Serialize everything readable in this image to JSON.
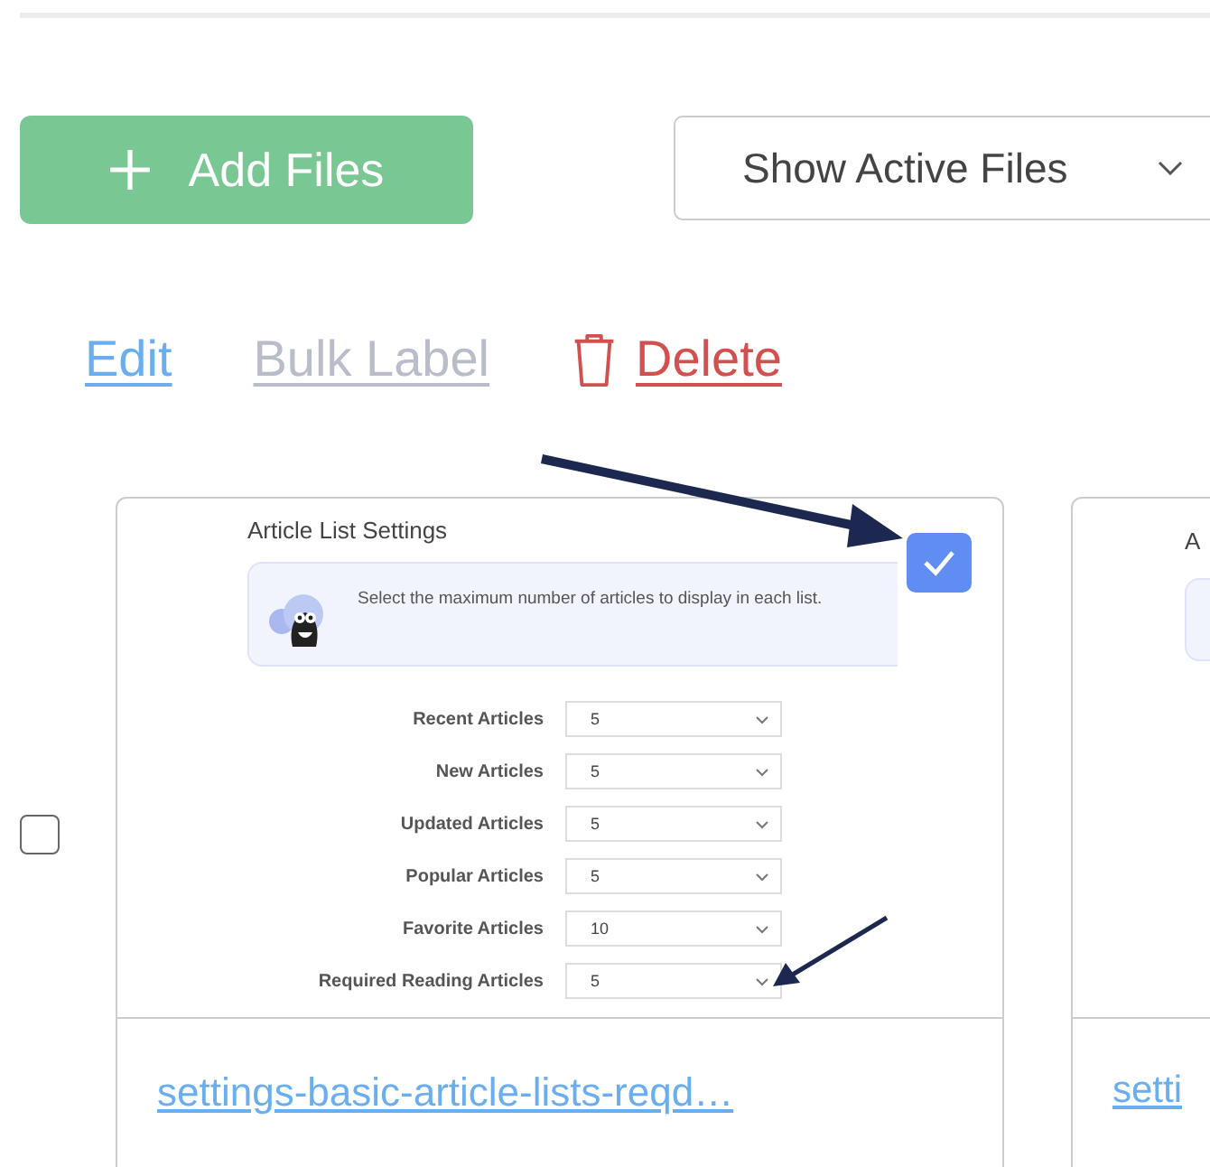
{
  "add_button": {
    "label": "Add Files"
  },
  "filter_dropdown": {
    "value": "Show Active Files"
  },
  "actions": [
    {
      "kind": "edit",
      "label": "Edit",
      "disabled": false
    },
    {
      "kind": "label",
      "label": "Bulk Label",
      "disabled": true
    },
    {
      "kind": "delete",
      "label": "Delete",
      "disabled": false
    }
  ],
  "files": [
    {
      "selected": false,
      "name": "settings-basic-article-lists-reqd…",
      "preview": {
        "title": "Article List Settings",
        "checked": true,
        "info": "Select the maximum number of articles to display in each list.",
        "rows": [
          {
            "label": "Recent Articles",
            "value": "5"
          },
          {
            "label": "New Articles",
            "value": "5"
          },
          {
            "label": "Updated Articles",
            "value": "5"
          },
          {
            "label": "Popular Articles",
            "value": "5"
          },
          {
            "label": "Favorite Articles",
            "value": "10"
          },
          {
            "label": "Required Reading Articles",
            "value": "5"
          }
        ]
      }
    },
    {
      "name": "setti",
      "preview": {
        "title": "A"
      }
    }
  ]
}
